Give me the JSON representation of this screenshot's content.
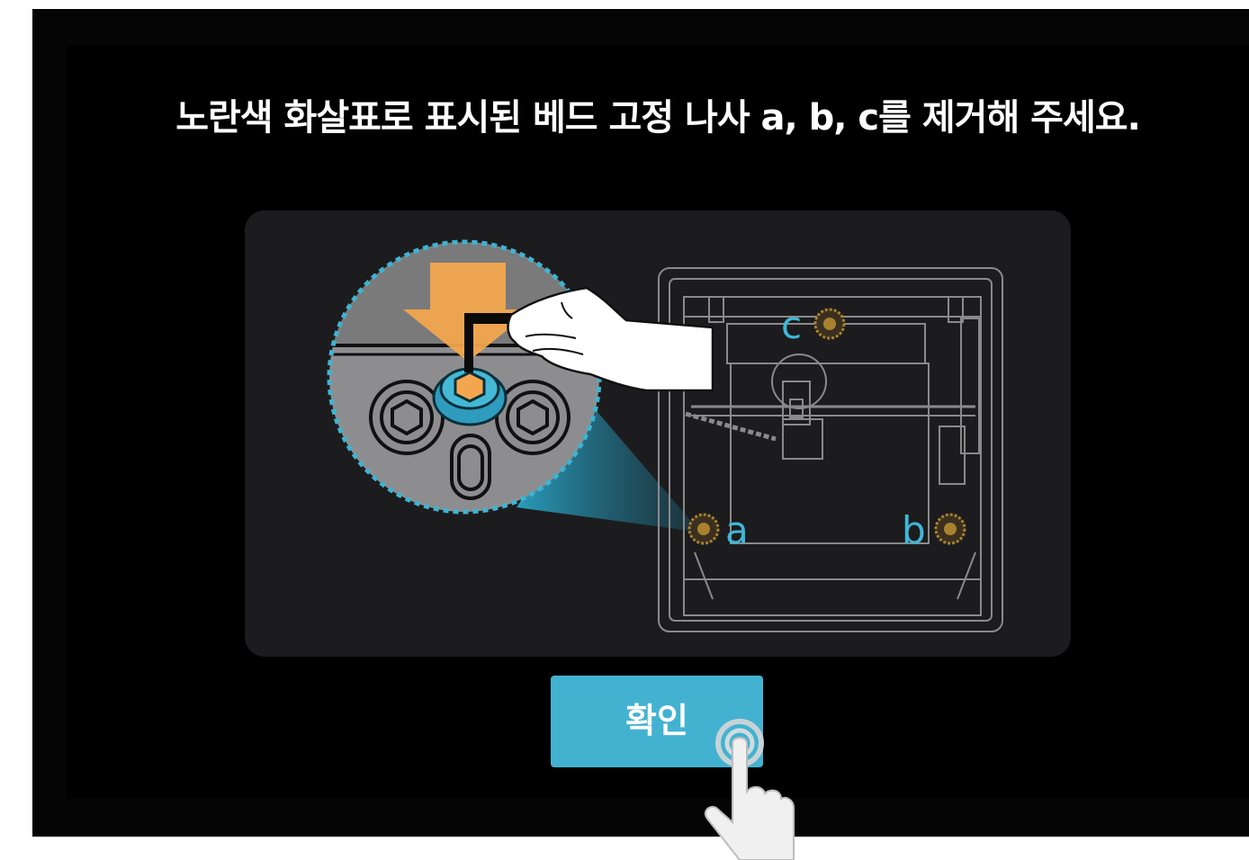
{
  "instruction": {
    "text": "노란색 화살표로 표시된 베드 고정 나사 a, b, c를 제거해 주세요."
  },
  "illustration": {
    "screw_labels": {
      "a": "a",
      "b": "b",
      "c": "c"
    },
    "icons": [
      "yellow-down-arrow-icon",
      "hex-wrench-hand-icon",
      "bed-screw-icon",
      "printer-top-view-icon"
    ]
  },
  "actions": {
    "confirm_label": "확인"
  },
  "colors": {
    "accent": "#43b2d0",
    "arrow": "#f3a64e",
    "label": "#3fb8d8",
    "screw": "#a8822e"
  }
}
